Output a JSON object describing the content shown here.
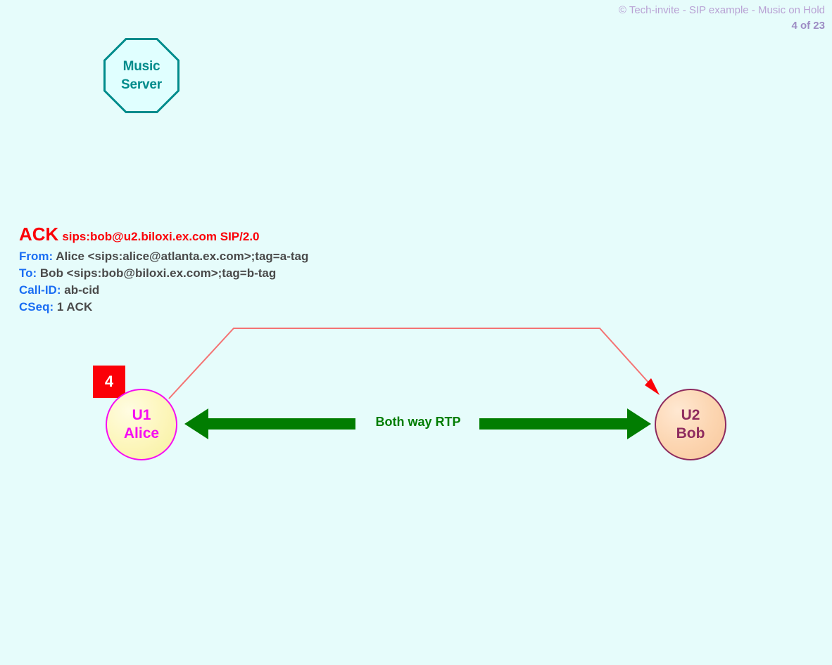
{
  "header": {
    "title": "© Tech-invite - SIP example - Music on Hold",
    "page": "4 of 23"
  },
  "colors": {
    "background": "#e6fcfb",
    "header_title": "#b9a2d4",
    "header_page": "#9d8cc4",
    "sip_method": "#fb0007",
    "sip_header_name": "#1b6ef3",
    "sip_header_value": "#4a4a4a",
    "alice_border": "#f50df3",
    "alice_fill": "#fdf7c0",
    "bob_border": "#8e2b5e",
    "bob_fill": "#fcd6b2",
    "music_server": "#008b8b",
    "music_server_fill": "#e0ffff",
    "badge": "#fb0007",
    "signal_arrow": "#f47373",
    "signal_arrowhead": "#fb0007",
    "rtp_arrow": "#017d01"
  },
  "music_server": {
    "line1": "Music",
    "line2": "Server",
    "icon": "octagon-icon"
  },
  "sip_message": {
    "method": "ACK",
    "request_uri": "sips:bob@u2.biloxi.ex.com SIP/2.0",
    "headers": [
      {
        "name": "From:",
        "value": "Alice <sips:alice@atlanta.ex.com>;tag=a-tag"
      },
      {
        "name": "To:",
        "value": "Bob <sips:bob@biloxi.ex.com>;tag=b-tag"
      },
      {
        "name": "Call-ID:",
        "value": "ab-cid"
      },
      {
        "name": "CSeq:",
        "value": "1 ACK"
      }
    ]
  },
  "endpoints": {
    "alice": {
      "id": "U1",
      "name": "Alice",
      "badge": "4"
    },
    "bob": {
      "id": "U2",
      "name": "Bob"
    }
  },
  "media": {
    "rtp_label": "Both way RTP"
  }
}
